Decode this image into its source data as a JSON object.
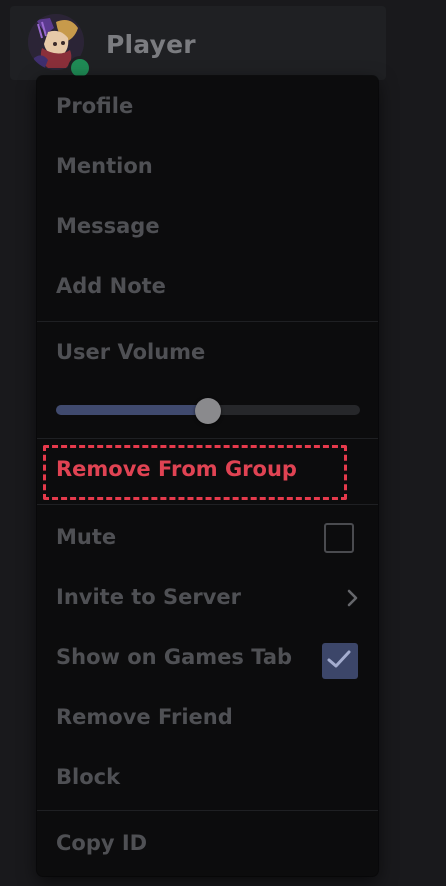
{
  "member": {
    "username": "Player",
    "status_color": "#1f8b55",
    "avatar_icon": "anime-character-avatar"
  },
  "menu": {
    "items_top": [
      {
        "label": "Profile"
      },
      {
        "label": "Mention"
      },
      {
        "label": "Message"
      },
      {
        "label": "Add Note"
      }
    ],
    "user_volume": {
      "label": "User Volume",
      "value_fraction": 0.5
    },
    "remove_from_group": {
      "label": "Remove From Group",
      "color": "#e04353"
    },
    "mute": {
      "label": "Mute",
      "checked": false
    },
    "invite": {
      "label": "Invite to Server",
      "icon": "chevron-right-icon"
    },
    "show_games": {
      "label": "Show on Games Tab",
      "checked": true
    },
    "remove_friend": {
      "label": "Remove Friend"
    },
    "block": {
      "label": "Block"
    },
    "copy_id": {
      "label": "Copy ID"
    }
  },
  "colors": {
    "background": "#19191c",
    "menu_bg": "#0c0c0d",
    "text_muted": "#4f5054",
    "accent": "#404a6e",
    "highlight_border": "#e63a4c"
  }
}
